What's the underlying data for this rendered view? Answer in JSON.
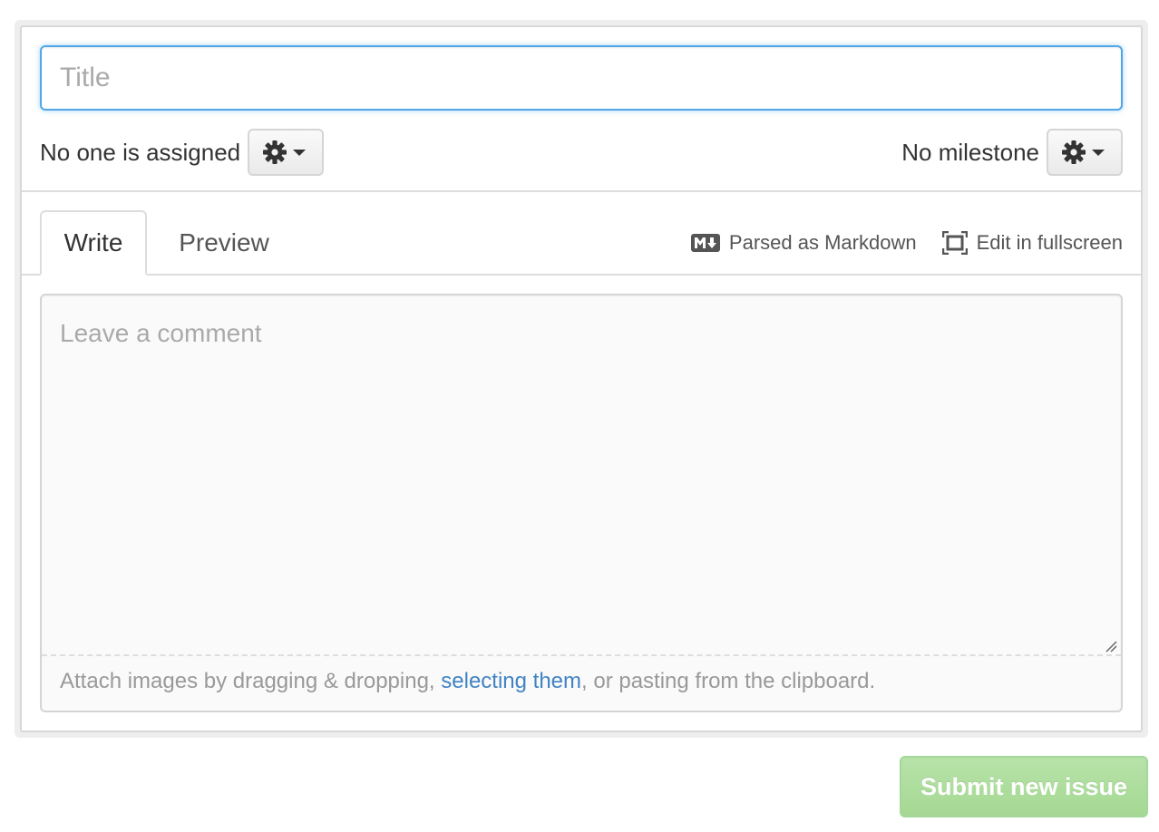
{
  "title_field": {
    "value": "",
    "placeholder": "Title"
  },
  "assignee": {
    "label": "No one is assigned",
    "button_icon": "gear-icon"
  },
  "milestone": {
    "label": "No milestone",
    "button_icon": "gear-icon"
  },
  "tabs": [
    {
      "label": "Write",
      "active": true
    },
    {
      "label": "Preview",
      "active": false
    }
  ],
  "toolbar": {
    "markdown_label": "Parsed as Markdown",
    "markdown_icon": "markdown-icon",
    "fullscreen_label": "Edit in fullscreen",
    "fullscreen_icon": "fullscreen-icon"
  },
  "comment": {
    "value": "",
    "placeholder": "Leave a comment",
    "attach_prefix": "Attach images by dragging & dropping, ",
    "attach_link": "selecting them",
    "attach_suffix": ", or pasting from the clipboard."
  },
  "submit_label": "Submit new issue",
  "colors": {
    "focus_border": "#51a7e8",
    "link": "#4183c4",
    "submit_bg": "#a5d893",
    "submit_text": "#ffffff"
  }
}
